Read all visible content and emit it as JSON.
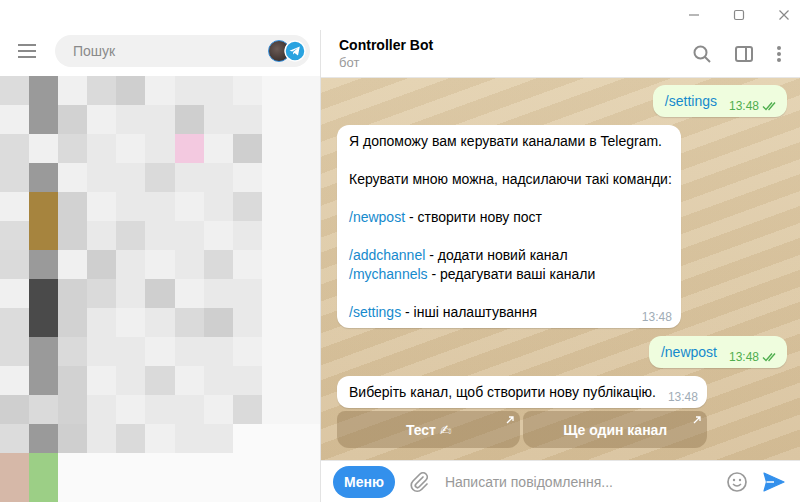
{
  "sidebar": {
    "search": {
      "placeholder": "Пошук"
    }
  },
  "chat": {
    "title": "Controller Bot",
    "subtitle": "бот"
  },
  "messages": [
    {
      "kind": "outgoing",
      "paragraphs": [
        [
          [
            {
              "text": "/settings",
              "command": true
            }
          ]
        ]
      ],
      "time": "13:48",
      "read": true
    },
    {
      "kind": "incoming",
      "paragraphs": [
        [
          [
            {
              "text": "Я допоможу вам керувати каналами в Telegram.",
              "command": false
            }
          ]
        ],
        [
          [
            {
              "text": "Керувати мною можна, надсилаючи такі команди:",
              "command": false
            }
          ]
        ],
        [
          [
            {
              "text": "/newpost",
              "command": true
            },
            {
              "text": " - створити нову пост",
              "command": false
            }
          ]
        ],
        [
          [
            {
              "text": "/addchannel",
              "command": true
            },
            {
              "text": " - додати новий канал",
              "command": false
            }
          ],
          [
            {
              "text": "/mychannels",
              "command": true
            },
            {
              "text": " - редагувати ваші канали",
              "command": false
            }
          ]
        ],
        [
          [
            {
              "text": "/settings",
              "command": true
            },
            {
              "text": " - інші налаштування",
              "command": false
            }
          ]
        ]
      ],
      "time": "13:48"
    },
    {
      "kind": "outgoing",
      "paragraphs": [
        [
          [
            {
              "text": "/newpost",
              "command": true
            }
          ]
        ]
      ],
      "time": "13:48",
      "read": true
    },
    {
      "kind": "incoming",
      "paragraphs": [
        [
          [
            {
              "text": "Виберіть канал, щоб створити нову публікацію.",
              "command": false
            }
          ]
        ]
      ],
      "time": "13:48"
    }
  ],
  "keyboard": [
    {
      "label": "Тест ✍"
    },
    {
      "label": "Ще один канал"
    }
  ],
  "composer": {
    "menu_button": "Меню",
    "placeholder": "Написати повідомлення..."
  }
}
